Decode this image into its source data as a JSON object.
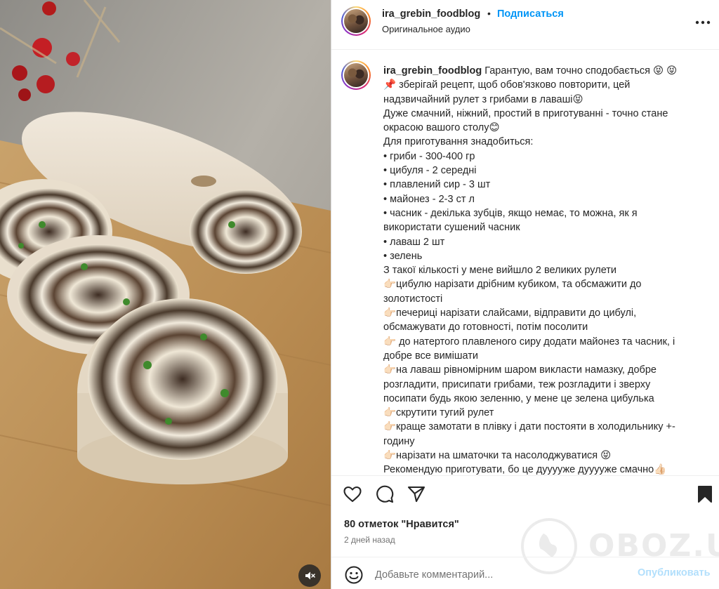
{
  "post": {
    "username": "ira_grebin_foodblog",
    "separator": "•",
    "follow_label": "Подписаться",
    "audio": "Оригинальное аудио"
  },
  "caption": {
    "username": "ira_grebin_foodblog",
    "first_text": "Гарантую, вам точно сподобається 😝 😝",
    "lines": [
      "📌 зберігай рецепт, щоб обов'язково повторити, цей",
      "надзвичайний рулет з грибами в лаваші😝",
      "Дуже смачний, ніжний, простий в приготуванні - точно стане",
      "окрасою вашого столу😊",
      "Для приготування знадобиться:",
      "• гриби - 300-400 гр",
      "• цибуля - 2 середні",
      "• плавлений сир - 3 шт",
      "• майонез - 2-3 ст л",
      "• часник - декілька зубців, якщо немає, то можна, як я",
      "використати сушений часник",
      "• лаваш 2 шт",
      "• зелень",
      "З такої кількості у мене вийшло 2 великих рулети",
      "👉🏻цибулю нарізати дрібним кубиком, та обсмажити до",
      "золотистості",
      "👉🏻печериці нарізати слайсами, відправити до цибулі,",
      "обсмажувати до готовності, потім посолити",
      "👉🏻 до натертого плавленого сиру додати майонез та часник, і",
      "добре все вимішати",
      "👉🏻на лаваш рівномірним шаром викласти намазку, добре",
      "розгладити, присипати грибами, теж розгладити і зверху",
      "посипати будь якою зеленню, у мене це зелена цибулька",
      "👉🏻скрутити тугий рулет",
      "👉🏻краще замотати в плівку і дати постояти в холодильнику +-",
      "годину",
      "👉🏻нарізати на шматочки та насолоджуватися 😝",
      "Рекомендую приготувати, бо це дууууже дууууже смачно👍🏻"
    ]
  },
  "actions": {
    "like_icon": "heart-icon",
    "comment_icon": "comment-icon",
    "share_icon": "send-icon",
    "save_icon": "bookmark-icon"
  },
  "likes_text": "80 отметок \"Нравится\"",
  "posted_ago": "2 дней назад",
  "comment": {
    "placeholder": "Добавьте комментарий...",
    "publish_label": "Опубликовать"
  },
  "watermark": {
    "text": "OBOZ.UA"
  },
  "colors": {
    "accent": "#0095f6",
    "publish_disabled": "#b2dffc",
    "text": "#262626",
    "muted": "#737373"
  }
}
